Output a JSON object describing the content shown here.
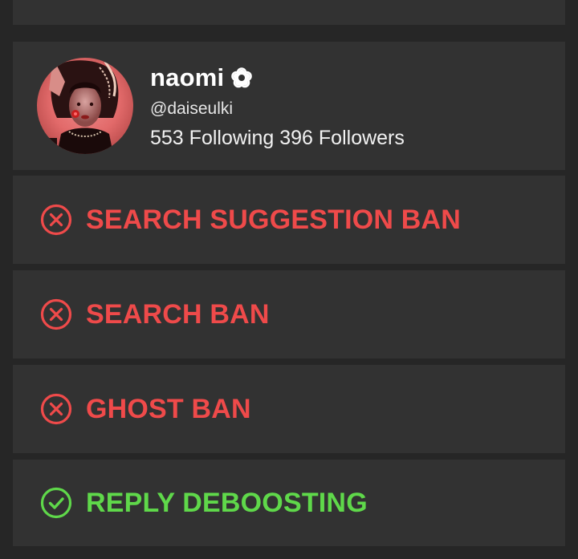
{
  "profile": {
    "name": "naomi",
    "name_icon": "flower-icon",
    "handle": "@daiseulki",
    "following_count": "553",
    "following_label": "Following",
    "followers_count": "396",
    "followers_label": "Followers"
  },
  "checks": [
    {
      "label": "SEARCH SUGGESTION BAN",
      "status": "fail",
      "icon": "x-circle-icon"
    },
    {
      "label": "SEARCH BAN",
      "status": "fail",
      "icon": "x-circle-icon"
    },
    {
      "label": "GHOST BAN",
      "status": "fail",
      "icon": "x-circle-icon"
    },
    {
      "label": "REPLY DEBOOSTING",
      "status": "pass",
      "icon": "check-circle-icon"
    }
  ],
  "colors": {
    "background": "#262626",
    "card": "#323232",
    "fail": "#ef4a4a",
    "pass": "#5fd84a",
    "text": "#ffffff"
  }
}
